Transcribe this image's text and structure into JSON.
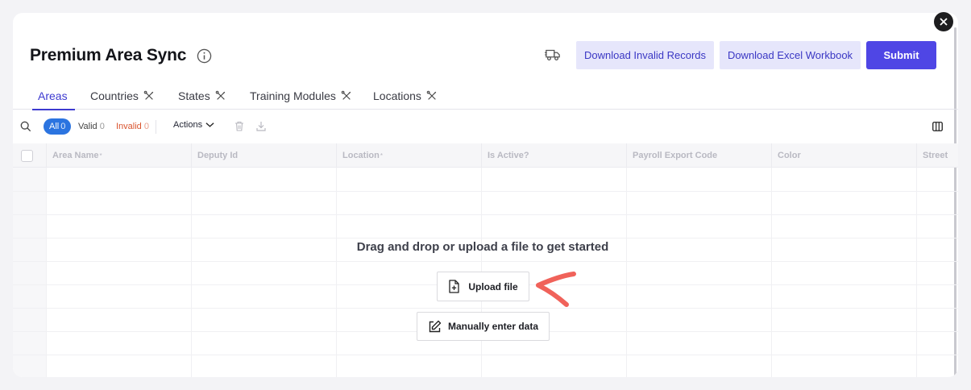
{
  "window": {
    "title": "Premium Area Sync",
    "close_icon": "close-icon"
  },
  "header": {
    "info_icon": "info-icon",
    "truck_icon": "truck-icon",
    "buttons": {
      "download_invalid": "Download Invalid Records",
      "download_excel": "Download Excel Workbook",
      "submit": "Submit"
    },
    "colors": {
      "accent": "#4f46e5",
      "light_button_bg": "#e6e6fb",
      "light_button_text": "#3a37c4"
    }
  },
  "tabs": [
    {
      "label": "Areas",
      "active": true
    },
    {
      "label": "Countries",
      "icon": "tools-icon"
    },
    {
      "label": "States",
      "icon": "tools-icon"
    },
    {
      "label": "Training Modules",
      "icon": "tools-icon"
    },
    {
      "label": "Locations",
      "icon": "tools-icon"
    }
  ],
  "toolbar": {
    "filters": {
      "all": {
        "label": "All",
        "count": "0"
      },
      "valid": {
        "label": "Valid",
        "count": "0"
      },
      "invalid": {
        "label": "Invalid",
        "count": "0"
      }
    },
    "actions_label": "Actions"
  },
  "grid": {
    "columns": [
      {
        "label": "Area Name",
        "required": true
      },
      {
        "label": "Deputy Id",
        "required": false
      },
      {
        "label": "Location",
        "required": true
      },
      {
        "label": "Is Active?",
        "required": false
      },
      {
        "label": "Payroll Export Code",
        "required": false
      },
      {
        "label": "Color",
        "required": false
      },
      {
        "label": "Street",
        "required": false
      }
    ],
    "required_mark": "*"
  },
  "empty_state": {
    "message": "Drag and drop or upload a file to get started",
    "upload_label": "Upload file",
    "manual_label": "Manually enter data"
  }
}
